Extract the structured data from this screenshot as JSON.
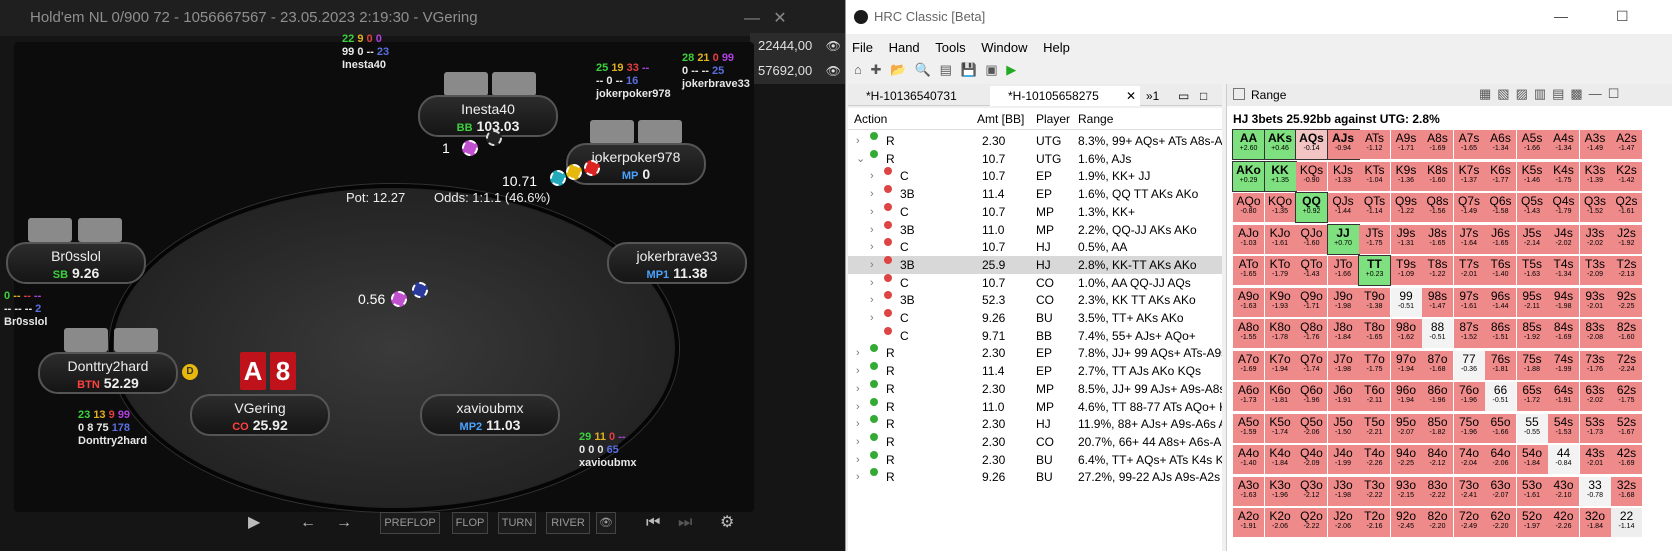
{
  "poker": {
    "title": "Hold'em NL 0/900 72 - 1056667567 - 23.05.2023 2:19:30 - VGering",
    "minimize": "—",
    "close": "✕",
    "stack1": "22444,00",
    "stack2": "57692,00",
    "pot": "Pot:  12.27",
    "odds": "Odds:  1:1.1 (46.6%)",
    "seats": [
      {
        "name": "Inesta40",
        "pos": "BB",
        "stack": "103.03",
        "poscolor": "#3dd03d"
      },
      {
        "name": "jokerpoker978",
        "pos": "MP",
        "stack": "0",
        "poscolor": "#4aa3ff"
      },
      {
        "name": "jokerbrave33",
        "pos": "MP1",
        "stack": "11.38",
        "poscolor": "#4aa3ff"
      },
      {
        "name": "xavioubmx",
        "pos": "MP2",
        "stack": "11.03",
        "poscolor": "#4aa3ff"
      },
      {
        "name": "VGering",
        "pos": "CO",
        "stack": "25.92",
        "poscolor": "#ff4040"
      },
      {
        "name": "Donttry2hard",
        "pos": "BTN",
        "stack": "52.29",
        "poscolor": "#ff4040"
      },
      {
        "name": "Br0sslol",
        "pos": "SB",
        "stack": "9.26",
        "poscolor": "#3dd03d"
      }
    ],
    "bets": {
      "inesta": "1",
      "joker": "10.71",
      "vg": "0.56"
    },
    "hero_cards": [
      "A",
      "8"
    ],
    "stats": {
      "inesta_l1": [
        "22",
        "9",
        "0",
        "0"
      ],
      "inesta_l2": [
        "99",
        "0",
        "--",
        "23"
      ],
      "inesta_name": "Inesta40",
      "jp_l1": [
        "25",
        "19",
        "33",
        "--"
      ],
      "jp_l2": [
        "--",
        "0",
        "--",
        "16"
      ],
      "jp_name": "jokerpoker978",
      "jb_l1": [
        "28",
        "21",
        "0",
        "99"
      ],
      "jb_l2": [
        "0",
        "--",
        "--",
        "25"
      ],
      "jb_name": "jokerbrave33",
      "br_l1": [
        "0",
        "--",
        "--",
        "--"
      ],
      "br_l2": [
        "--",
        "--",
        "--",
        "2"
      ],
      "br_name": "Br0sslol",
      "dt_l1": [
        "23",
        "13",
        "9",
        "99"
      ],
      "dt_l2": [
        "0",
        "8",
        "75",
        "178"
      ],
      "dt_name": "Donttry2hard",
      "xv_l1": [
        "29",
        "11",
        "0",
        "--"
      ],
      "xv_l2": [
        "0",
        "0",
        "0",
        "65"
      ],
      "xv_name": "xavioubmx"
    },
    "controls": [
      "PREFLOP",
      "FLOP",
      "TURN",
      "RIVER"
    ]
  },
  "hrc": {
    "title": "HRC Classic [Beta]",
    "menu": [
      "File",
      "Hand",
      "Tools",
      "Window",
      "Help"
    ],
    "tab1": "*H-10136540731",
    "tab2": "*H-10105658275",
    "tab3": "»1",
    "cols": [
      "Action",
      "Amt [BB]",
      "Player",
      "Range"
    ],
    "rows": [
      {
        "a": "R",
        "amt": "2.30",
        "p": "UTG",
        "r": "8.3%, 99+ AQs+ ATs A8s-A",
        "c": "#3a3",
        "d": 0,
        "arrow": "›"
      },
      {
        "a": "R",
        "amt": "10.7",
        "p": "UTG",
        "r": "1.6%, AJs",
        "c": "#3a3",
        "d": 0,
        "arrow": "⌄"
      },
      {
        "a": "C",
        "amt": "10.7",
        "p": "EP",
        "r": "1.9%, KK+ JJ",
        "c": "#d44",
        "d": 1,
        "arrow": "›"
      },
      {
        "a": "3B",
        "amt": "11.4",
        "p": "EP",
        "r": "1.6%, QQ TT AKs AKo",
        "c": "#d44",
        "d": 1,
        "arrow": "›"
      },
      {
        "a": "C",
        "amt": "10.7",
        "p": "MP",
        "r": "1.3%, KK+",
        "c": "#d44",
        "d": 1,
        "arrow": "›"
      },
      {
        "a": "3B",
        "amt": "11.0",
        "p": "MP",
        "r": "2.2%, QQ-JJ AKs AKo",
        "c": "#d44",
        "d": 1,
        "arrow": "›"
      },
      {
        "a": "C",
        "amt": "10.7",
        "p": "HJ",
        "r": "0.5%, AA",
        "c": "#d44",
        "d": 1,
        "arrow": "›"
      },
      {
        "a": "3B",
        "amt": "25.9",
        "p": "HJ",
        "r": "2.8%, KK-TT AKs AKo",
        "c": "#d44",
        "d": 1,
        "arrow": "›",
        "sel": true
      },
      {
        "a": "C",
        "amt": "10.7",
        "p": "CO",
        "r": "1.0%, AA QQ-JJ AQs",
        "c": "#d44",
        "d": 1,
        "arrow": "›"
      },
      {
        "a": "3B",
        "amt": "52.3",
        "p": "CO",
        "r": "2.3%, KK TT AKs AKo",
        "c": "#d44",
        "d": 1,
        "arrow": "›"
      },
      {
        "a": "C",
        "amt": "9.26",
        "p": "BU",
        "r": "3.5%, TT+ AKs AKo",
        "c": "#d44",
        "d": 1,
        "arrow": "›"
      },
      {
        "a": "C",
        "amt": "9.71",
        "p": "BB",
        "r": "7.4%, 55+ AJs+ AQo+",
        "c": "#d44",
        "d": 1,
        "arrow": ""
      },
      {
        "a": "R",
        "amt": "2.30",
        "p": "EP",
        "r": "7.8%, JJ+ 99 AQs+ ATs-A9s",
        "c": "#3a3",
        "d": 0,
        "arrow": "›"
      },
      {
        "a": "R",
        "amt": "11.4",
        "p": "EP",
        "r": "2.7%, TT AJs AKo KQs",
        "c": "#3a3",
        "d": 0,
        "arrow": "›"
      },
      {
        "a": "R",
        "amt": "2.30",
        "p": "MP",
        "r": "8.5%, JJ+ 99 AJs+ A9s-A8s",
        "c": "#3a3",
        "d": 0,
        "arrow": "›"
      },
      {
        "a": "R",
        "amt": "11.0",
        "p": "MP",
        "r": "4.6%, TT 88-77 ATs AQo+ K",
        "c": "#3a3",
        "d": 0,
        "arrow": "›"
      },
      {
        "a": "R",
        "amt": "2.30",
        "p": "HJ",
        "r": "11.9%, 88+ AJs+ A9s-A6s A",
        "c": "#3a3",
        "d": 0,
        "arrow": "›"
      },
      {
        "a": "R",
        "amt": "2.30",
        "p": "CO",
        "r": "20.7%, 66+ 44 A8s+ A6s-A",
        "c": "#3a3",
        "d": 0,
        "arrow": "›"
      },
      {
        "a": "R",
        "amt": "2.30",
        "p": "BU",
        "r": "6.4%, TT+ AQs+ ATs K4s KS",
        "c": "#3a3",
        "d": 0,
        "arrow": "›"
      },
      {
        "a": "R",
        "amt": "9.26",
        "p": "BU",
        "r": "27.2%, 99-22 AJs A9s-A2s A",
        "c": "#3a3",
        "d": 0,
        "arrow": "›"
      }
    ],
    "range_tab": "Range",
    "range_title": "HJ 3bets 25.92bb against UTG: 2.8%",
    "grid": [
      [
        "AA",
        "AKs",
        "AQs",
        "AJs",
        "ATs",
        "A9s",
        "A8s",
        "A7s",
        "A6s",
        "A5s",
        "A4s",
        "A3s",
        "A2s"
      ],
      [
        "AKo",
        "KK",
        "KQs",
        "KJs",
        "KTs",
        "K9s",
        "K8s",
        "K7s",
        "K6s",
        "K5s",
        "K4s",
        "K3s",
        "K2s"
      ],
      [
        "AQo",
        "KQo",
        "QQ",
        "QJs",
        "QTs",
        "Q9s",
        "Q8s",
        "Q7s",
        "Q6s",
        "Q5s",
        "Q4s",
        "Q3s",
        "Q2s"
      ],
      [
        "AJo",
        "KJo",
        "QJo",
        "JJ",
        "JTs",
        "J9s",
        "J8s",
        "J7s",
        "J6s",
        "J5s",
        "J4s",
        "J3s",
        "J2s"
      ],
      [
        "ATo",
        "KTo",
        "QTo",
        "JTo",
        "TT",
        "T9s",
        "T8s",
        "T7s",
        "T6s",
        "T5s",
        "T4s",
        "T3s",
        "T2s"
      ],
      [
        "A9o",
        "K9o",
        "Q9o",
        "J9o",
        "T9o",
        "99",
        "98s",
        "97s",
        "96s",
        "95s",
        "94s",
        "93s",
        "92s"
      ],
      [
        "A8o",
        "K8o",
        "Q8o",
        "J8o",
        "T8o",
        "98o",
        "88",
        "87s",
        "86s",
        "85s",
        "84s",
        "83s",
        "82s"
      ],
      [
        "A7o",
        "K7o",
        "Q7o",
        "J7o",
        "T7o",
        "97o",
        "87o",
        "77",
        "76s",
        "75s",
        "74s",
        "73s",
        "72s"
      ],
      [
        "A6o",
        "K6o",
        "Q6o",
        "J6o",
        "T6o",
        "96o",
        "86o",
        "76o",
        "66",
        "65s",
        "64s",
        "63s",
        "62s"
      ],
      [
        "A5o",
        "K5o",
        "Q5o",
        "J5o",
        "T5o",
        "95o",
        "85o",
        "75o",
        "65o",
        "55",
        "54s",
        "53s",
        "52s"
      ],
      [
        "A4o",
        "K4o",
        "Q4o",
        "J4o",
        "T4o",
        "94o",
        "84o",
        "74o",
        "64o",
        "54o",
        "44",
        "43s",
        "42s"
      ],
      [
        "A3o",
        "K3o",
        "Q3o",
        "J3o",
        "T3o",
        "93o",
        "83o",
        "73o",
        "63o",
        "53o",
        "43o",
        "33",
        "32s"
      ],
      [
        "A2o",
        "K2o",
        "Q2o",
        "J2o",
        "T2o",
        "92o",
        "82o",
        "72o",
        "62o",
        "52o",
        "42o",
        "32o",
        "22"
      ]
    ],
    "ev": [
      [
        "+2.60",
        "+0.46",
        "-0.14",
        "-0.94",
        "-1.12",
        "-1.71",
        "-1.69",
        "-1.65",
        "-1.34",
        "-1.66",
        "-1.34",
        "-1.49",
        "-1.47"
      ],
      [
        "+0.29",
        "+1.35",
        "-0.90",
        "-1.33",
        "-1.04",
        "-1.36",
        "-1.60",
        "-1.37",
        "-1.77",
        "-1.46",
        "-1.75",
        "-1.39",
        "-1.42"
      ],
      [
        "-0.80",
        "-1.35",
        "+0.92",
        "-1.44",
        "-1.14",
        "-1.22",
        "-1.56",
        "-1.49",
        "-1.58",
        "-1.43",
        "-1.79",
        "-1.52",
        "-1.61"
      ],
      [
        "-1.03",
        "-1.61",
        "-1.60",
        "+0.70",
        "-1.75",
        "-1.31",
        "-1.65",
        "-1.64",
        "-1.65",
        "-2.14",
        "-2.02",
        "-2.02",
        "-1.92"
      ],
      [
        "-1.65",
        "-1.79",
        "-1.43",
        "-1.66",
        "+0.23",
        "-1.09",
        "-1.22",
        "-2.01",
        "-1.40",
        "-1.63",
        "-1.34",
        "-2.09",
        "-2.13"
      ],
      [
        "-1.63",
        "-1.93",
        "-1.71",
        "-1.98",
        "-1.38",
        "-0.51",
        "-1.47",
        "-1.61",
        "-1.44",
        "-2.11",
        "-1.98",
        "-2.01",
        "-2.25"
      ],
      [
        "-1.55",
        "-1.78",
        "-1.76",
        "-1.84",
        "-1.65",
        "-1.62",
        "-0.51",
        "-1.52",
        "-1.51",
        "-1.92",
        "-1.69",
        "-2.08",
        "-1.60"
      ],
      [
        "-1.69",
        "-1.94",
        "-1.74",
        "-1.98",
        "-1.75",
        "-1.94",
        "-1.68",
        "-0.36",
        "-1.81",
        "-1.88",
        "-1.99",
        "-1.76",
        "-2.24"
      ],
      [
        "-1.73",
        "-1.81",
        "-1.96",
        "-1.91",
        "-2.11",
        "-1.94",
        "-1.96",
        "-1.96",
        "-0.51",
        "-1.72",
        "-1.91",
        "-2.02",
        "-1.75"
      ],
      [
        "-1.59",
        "-1.74",
        "-2.06",
        "-1.50",
        "-2.21",
        "-2.07",
        "-1.82",
        "-1.96",
        "-1.66",
        "-0.55",
        "-1.53",
        "-1.73",
        "-1.67"
      ],
      [
        "-1.40",
        "-1.84",
        "-2.09",
        "-1.99",
        "-2.26",
        "-2.25",
        "-2.12",
        "-2.04",
        "-2.06",
        "-1.84",
        "-0.84",
        "-2.01",
        "-1.69"
      ],
      [
        "-1.63",
        "-1.96",
        "-2.12",
        "-1.98",
        "-2.22",
        "-2.15",
        "-2.22",
        "-2.41",
        "-2.07",
        "-1.61",
        "-2.10",
        "-0.78",
        "-1.68"
      ],
      [
        "-1.91",
        "-2.06",
        "-2.22",
        "-2.06",
        "-2.16",
        "-2.45",
        "-2.20",
        "-2.49",
        "-2.20",
        "-1.97",
        "-2.26",
        "-1.84",
        "-1.14"
      ]
    ],
    "highlight": [
      "AA",
      "AKs",
      "AKo",
      "KK",
      "QQ",
      "JJ",
      "TT",
      "AQs",
      "AJs"
    ]
  }
}
